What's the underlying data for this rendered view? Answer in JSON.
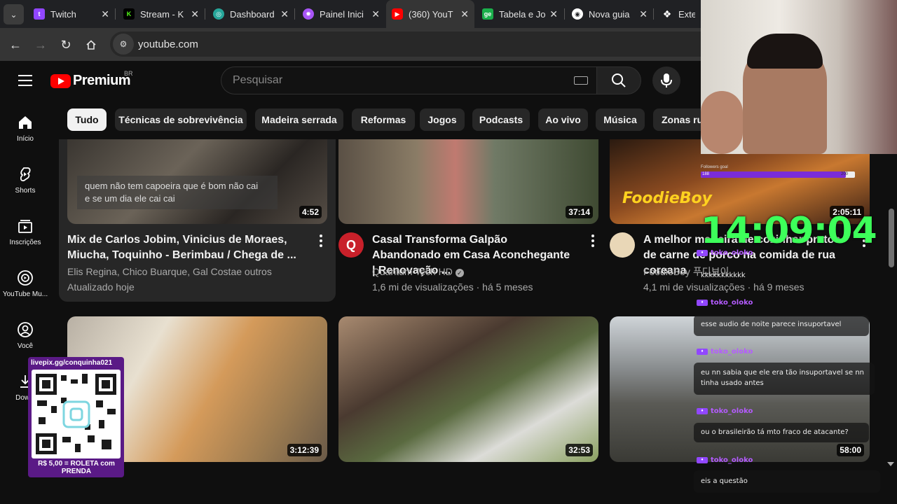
{
  "tabs": [
    {
      "title": "Twitch",
      "icon": "twitch-icon",
      "color": "#9146ff"
    },
    {
      "title": "Stream - K",
      "icon": "kick-icon",
      "color": "#53fc18"
    },
    {
      "title": "Dashboard",
      "icon": "streamelements-icon",
      "color": "#26a69a"
    },
    {
      "title": "Painel Inici",
      "icon": "livepix-icon",
      "color": "#a855f7"
    },
    {
      "title": "(360) YouT",
      "icon": "youtube-icon",
      "color": "#ff0000"
    },
    {
      "title": "Tabela e Jo",
      "icon": "ge-icon",
      "color": "#1aaf4b"
    },
    {
      "title": "Nova guia",
      "icon": "chrome-icon",
      "color": "#ffffff"
    },
    {
      "title": "Extens",
      "icon": "puzzle-icon",
      "color": "#ffffff"
    }
  ],
  "toolbar": {
    "url": "youtube.com"
  },
  "header": {
    "logo_text": "Premium",
    "region": "BR",
    "search_placeholder": "Pesquisar"
  },
  "sidebar": {
    "items": [
      {
        "label": "Início",
        "icon": "home-icon"
      },
      {
        "label": "Shorts",
        "icon": "shorts-icon"
      },
      {
        "label": "Inscrições",
        "icon": "subscriptions-icon"
      },
      {
        "label": "YouTube Mu...",
        "icon": "youtube-music-icon"
      },
      {
        "label": "Você",
        "icon": "user-icon"
      },
      {
        "label": "Downl",
        "icon": "download-icon"
      }
    ]
  },
  "chips": [
    "Tudo",
    "Técnicas de sobrevivência",
    "Madeira serrada",
    "Reformas",
    "Jogos",
    "Podcasts",
    "Ao vivo",
    "Música",
    "Zonas ru"
  ],
  "videos": [
    {
      "duration": "4:52",
      "caption": "quem não tem capoeira que é bom não cai\ne se um dia ele cai cai",
      "title": "Mix de Carlos Jobim, Vinicius de Moraes, Miucha, Toquinho - Berimbau / Chega de ...",
      "meta1": "Elis Regina, Chico Buarque, Gal Costae outros",
      "meta2": "Atualizado hoje"
    },
    {
      "duration": "37:14",
      "title": "Casal Transforma Galpão Abandonado em Casa Aconchegante | Renovação ...",
      "meta1": "Quantum Tech HD",
      "meta2": "1,6 mi de visualizações · há 5 meses"
    },
    {
      "duration": "2:05:11",
      "thumb_text": "FoodieBoy",
      "title": "A melhor maneira de cozinhar pratos de carne de porco na comida de rua coreana",
      "meta1": "FoodieBoy 푸디보이",
      "meta2": "4,1 mi de visualizações · há 9 meses"
    },
    {
      "duration": "3:12:39"
    },
    {
      "duration": "32:53"
    },
    {
      "duration": "58:00"
    }
  ],
  "overlay": {
    "clock": "14:09:04",
    "goal_label": "Followers goal",
    "goal_current": "188",
    "goal_target": "200",
    "goal_progress": 0.94,
    "qr_url": "livepix.gg/conquinha021",
    "qr_caption": "R$ 5,00 = ROLETA com PRENDA",
    "chat": [
      {
        "user": "toko_oloko",
        "text": "kkkkkkkkkkk"
      },
      {
        "user": "toko_oloko",
        "text": "esse audio de noite parece insuportavel"
      },
      {
        "user": "toko_oloko",
        "text": "eu nn sabia que ele era tão insuportavel se nn tinha usado antes"
      },
      {
        "user": "toko_oloko",
        "text": "ou o brasileirão tá mto fraco de atacante?"
      },
      {
        "user": "toko_oloko",
        "text": "eis a questão"
      }
    ]
  },
  "colors": {
    "accent": "#ff0000",
    "clock": "#3dff5a",
    "chat_name": "#b45bff"
  }
}
